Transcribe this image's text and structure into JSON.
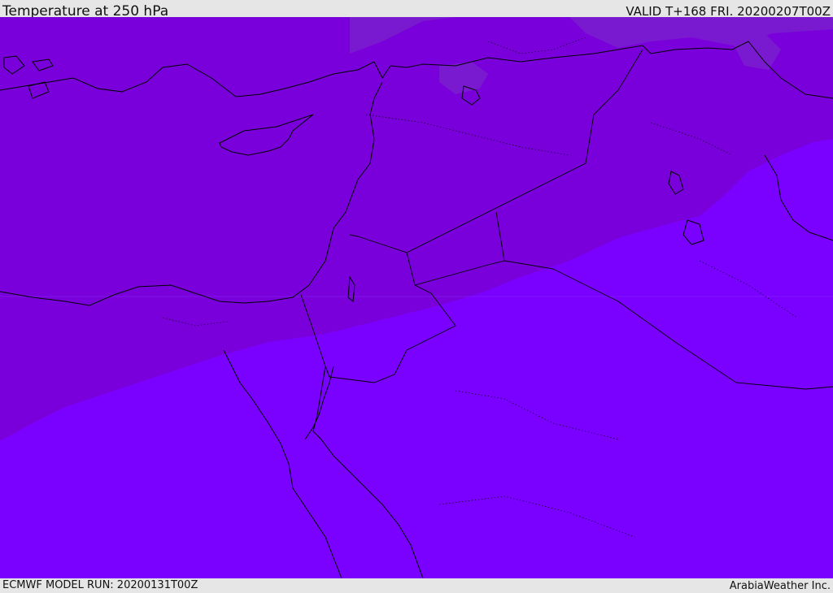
{
  "header": {
    "title": "Temperature at 250 hPa",
    "valid": "VALID T+168 FRI. 20200207T00Z"
  },
  "footer": {
    "model_run": "ECMWF MODEL RUN: 20200131T00Z",
    "credit": "ArabiaWeather Inc."
  },
  "colors": {
    "background_bar": "#e6e6e6",
    "temp_band_cold_north": "#7a1ad0",
    "temp_band_mid": "#7a00db",
    "temp_band_warm_south": "#7a00ff",
    "coastline": "#000000"
  }
}
